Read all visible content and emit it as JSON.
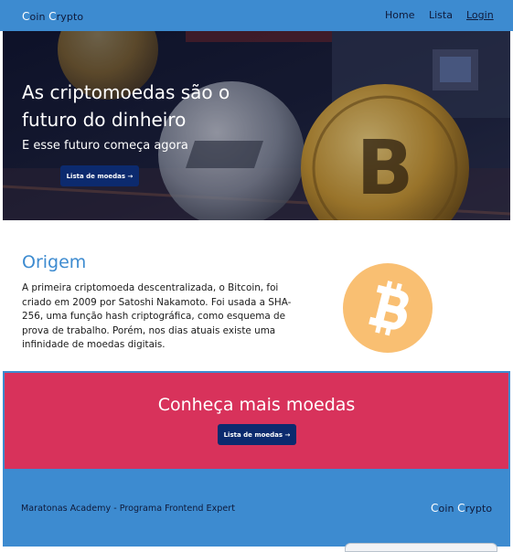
{
  "header": {
    "brand": {
      "cap1": "C",
      "rest1": "oin ",
      "cap2": "C",
      "rest2": "rypto"
    },
    "nav": {
      "home": "Home",
      "lista": "Lista",
      "login": "Login"
    }
  },
  "hero": {
    "title": "As criptomoedas são o futuro do dinheiro",
    "subtitle": "E esse futuro começa agora",
    "button_label": "Lista de moedas →"
  },
  "origem": {
    "title": "Origem",
    "text": "A primeira criptomoeda descentralizada, o Bitcoin, foi criado em 2009 por Satoshi Nakamoto. Foi usada a SHA-256, uma função hash criptográfica, como esquema de prova de trabalho. Porém, nos dias atuais existe uma infinidade de moedas digitais.",
    "coin_icon": "bitcoin-icon"
  },
  "promo": {
    "title": "Conheça mais moedas",
    "button_label": "Lista de moedas →"
  },
  "footer": {
    "text": "Maratonas Academy - Programa Frontend Expert",
    "brand": {
      "cap1": "C",
      "rest1": "oin ",
      "cap2": "C",
      "rest2": "rypto"
    }
  },
  "colors": {
    "header_bg": "#3d8bd0",
    "title_blue": "#3d8bd0",
    "button_bg": "#0c2a6e",
    "promo_bg": "#d8325b",
    "bitcoin_orange": "#f9bf72"
  }
}
